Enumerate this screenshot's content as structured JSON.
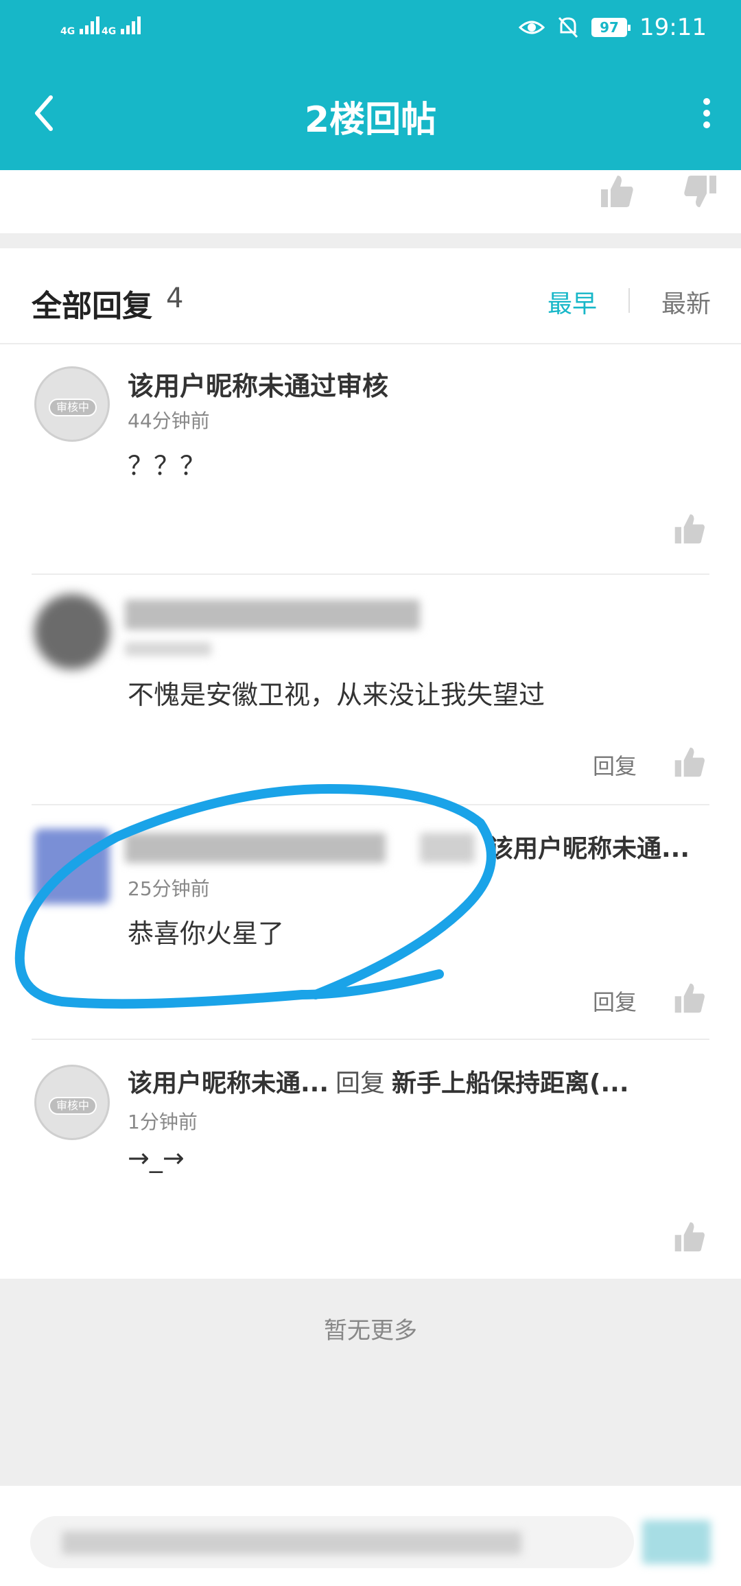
{
  "status_bar": {
    "time": "19:11",
    "battery": "97",
    "network1": "4G",
    "network2": "4G"
  },
  "app_bar": {
    "title": "2楼回帖"
  },
  "replies_header": {
    "label": "全部回复",
    "count": "4",
    "sort_earliest": "最早",
    "sort_latest": "最新"
  },
  "comments": [
    {
      "user": "该用户昵称未通过审核",
      "avatar_tag": "审核中",
      "time": "44分钟前",
      "text": "？？？",
      "reply_label": ""
    },
    {
      "user": "",
      "time": "",
      "text": "不愧是安徽卫视，从来没让我失望过",
      "reply_label": "回复"
    },
    {
      "user_reply_target": "该用户昵称未通...",
      "time": "25分钟前",
      "text": "恭喜你火星了",
      "reply_label": "回复"
    },
    {
      "user": "该用户昵称未通...",
      "avatar_tag": "审核中",
      "reply_word": "回复",
      "reply_target": "新手上船保持距离(...",
      "time": "1分钟前",
      "text": "→_→",
      "reply_label": ""
    }
  ],
  "footer": {
    "no_more": "暂无更多"
  },
  "colors": {
    "accent": "#17b7c8",
    "annotation": "#1aa3e8"
  }
}
